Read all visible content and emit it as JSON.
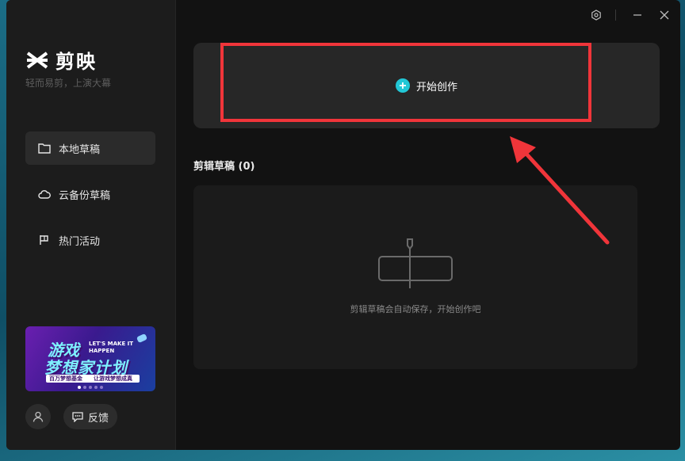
{
  "app": {
    "logo_text": "剪映",
    "slogan": "轻而易剪，上演大幕"
  },
  "sidebar": {
    "items": [
      {
        "label": "本地草稿",
        "icon": "folder-icon",
        "active": true
      },
      {
        "label": "云备份草稿",
        "icon": "cloud-icon",
        "active": false
      },
      {
        "label": "热门活动",
        "icon": "flag-icon",
        "active": false
      }
    ],
    "banner": {
      "line1": "游戏",
      "line2": "梦想家计划",
      "tagline": "LET'S MAKE IT HAPPEN",
      "strip_left": "百万梦想基金",
      "strip_right": "让游戏梦想成真"
    },
    "feedback_label": "反馈"
  },
  "main": {
    "create_label": "开始创作",
    "drafts_title": "剪辑草稿 (0)",
    "empty_text": "剪辑草稿会自动保存，开始创作吧"
  },
  "colors": {
    "accent": "#22c7d6",
    "highlight": "#f0353a",
    "background": "#121212",
    "sidebar": "#1c1c1c"
  }
}
